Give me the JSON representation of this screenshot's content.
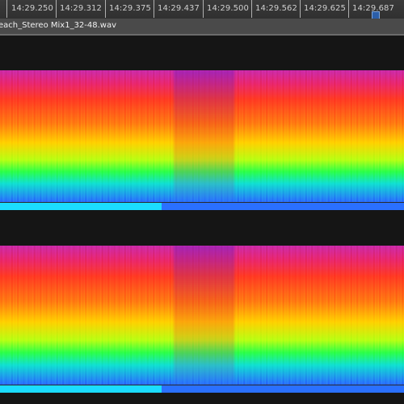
{
  "timeline": {
    "ticks": [
      {
        "label": "14:29.250"
      },
      {
        "label": "14:29.312"
      },
      {
        "label": "14:29.375"
      },
      {
        "label": "14:29.437"
      },
      {
        "label": "14:29.500"
      },
      {
        "label": "14:29.562"
      },
      {
        "label": "14:29.625"
      },
      {
        "label": "14:29.687"
      }
    ]
  },
  "file": {
    "name": "each_Stereo Mix1_32-48.wav"
  },
  "spectrogram": {
    "channels": [
      "top",
      "bottom"
    ],
    "colors": {
      "high": "#cc2aa9",
      "mid_high": "#ff3a23",
      "mid": "#ffd100",
      "mid_low": "#2cff4a",
      "low": "#2a6dff"
    }
  }
}
